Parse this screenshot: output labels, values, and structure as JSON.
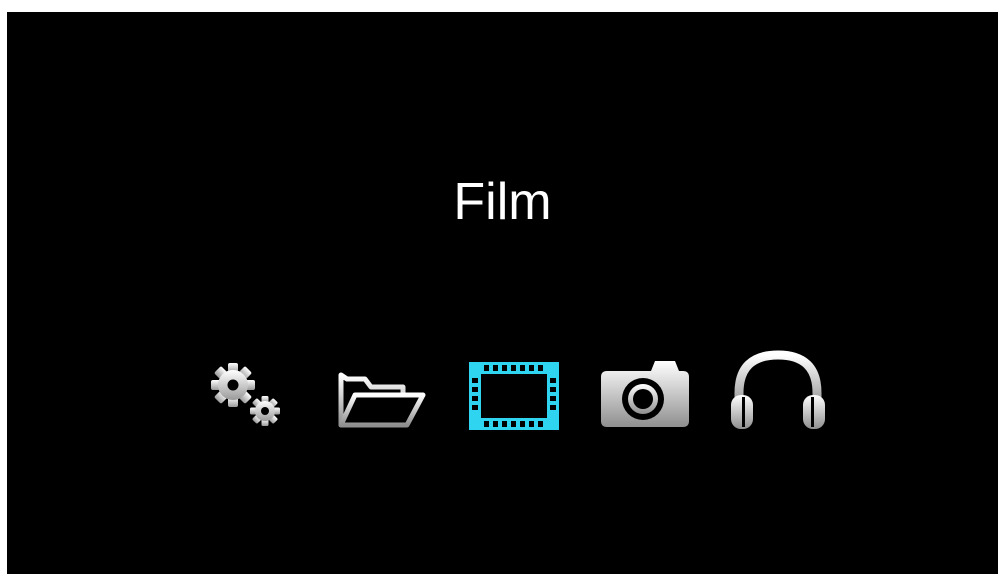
{
  "menu": {
    "selected_title": "Film",
    "selected_index": 2,
    "accent_color": "#2fd4f0",
    "icon_color": "#e6e6e6",
    "items": [
      {
        "icon": "settings-gears-icon",
        "selected": false
      },
      {
        "icon": "folder-open-icon",
        "selected": false
      },
      {
        "icon": "film-strip-icon",
        "selected": true
      },
      {
        "icon": "camera-icon",
        "selected": false
      },
      {
        "icon": "headphones-icon",
        "selected": false
      }
    ]
  }
}
